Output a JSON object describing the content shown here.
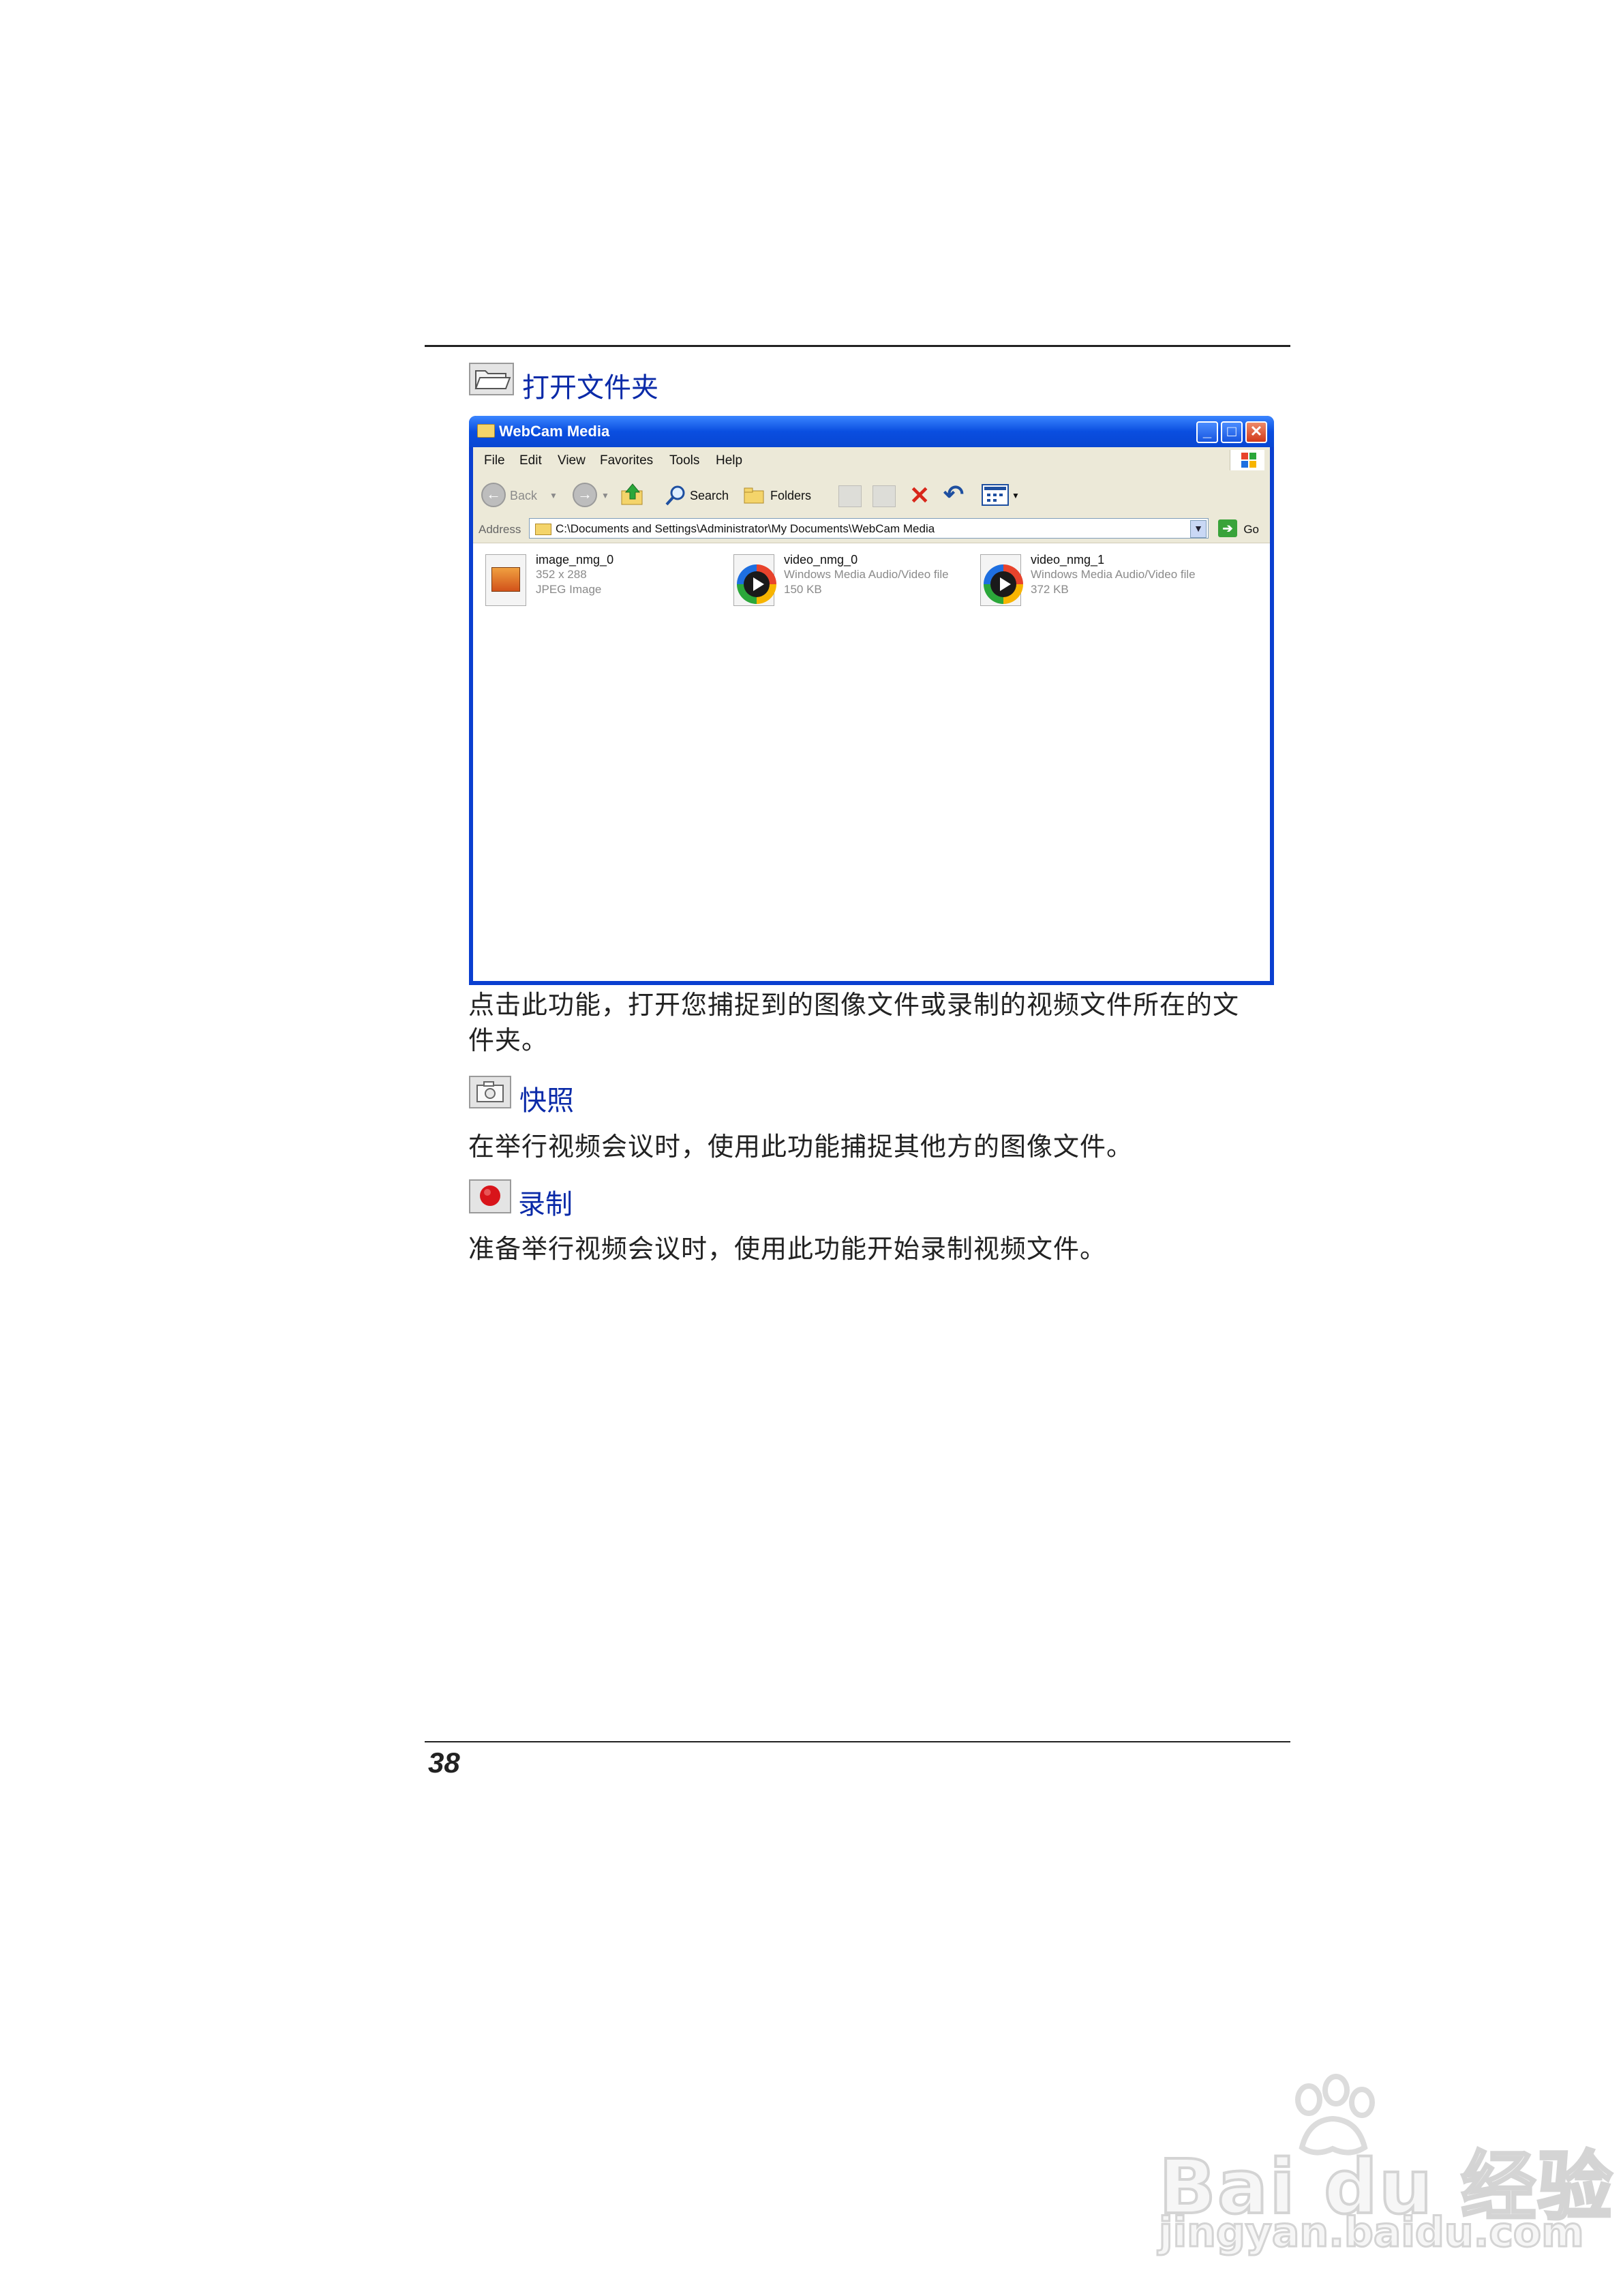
{
  "sections": {
    "open_folder": {
      "title": "打开文件夹",
      "description": "点击此功能，打开您捕捉到的图像文件或录制的视频文件所在的文件夹。",
      "description_line1": "点击此功能，打开您捕捉到的图像文件或录制的视频文件所在的文",
      "description_line2": "件夹。"
    },
    "snapshot": {
      "title": "快照",
      "description": "在举行视频会议时，使用此功能捕捉其他方的图像文件。"
    },
    "record": {
      "title": "录制",
      "description": "准备举行视频会议时，使用此功能开始录制视频文件。"
    }
  },
  "window": {
    "title": "WebCam Media",
    "menu": [
      "File",
      "Edit",
      "View",
      "Favorites",
      "Tools",
      "Help"
    ],
    "toolbar": {
      "back_label": "Back",
      "search_label": "Search",
      "folders_label": "Folders"
    },
    "address": {
      "label": "Address",
      "value": "C:\\Documents and Settings\\Administrator\\My Documents\\WebCam Media",
      "go_label": "Go"
    },
    "files": [
      {
        "name": "image_nmg_0",
        "line2": "352 x 288",
        "line3": "JPEG Image",
        "icon": "jpeg-image-icon"
      },
      {
        "name": "video_nmg_0",
        "line2": "Windows Media Audio/Video file",
        "line3": "150 KB",
        "icon": "windows-media-file-icon"
      },
      {
        "name": "video_nmg_1",
        "line2": "Windows Media Audio/Video file",
        "line3": "372 KB",
        "icon": "windows-media-file-icon"
      }
    ]
  },
  "page_number": "38",
  "watermark": {
    "brand": "Bai du 经验",
    "url": "jingyan.baidu.com"
  }
}
